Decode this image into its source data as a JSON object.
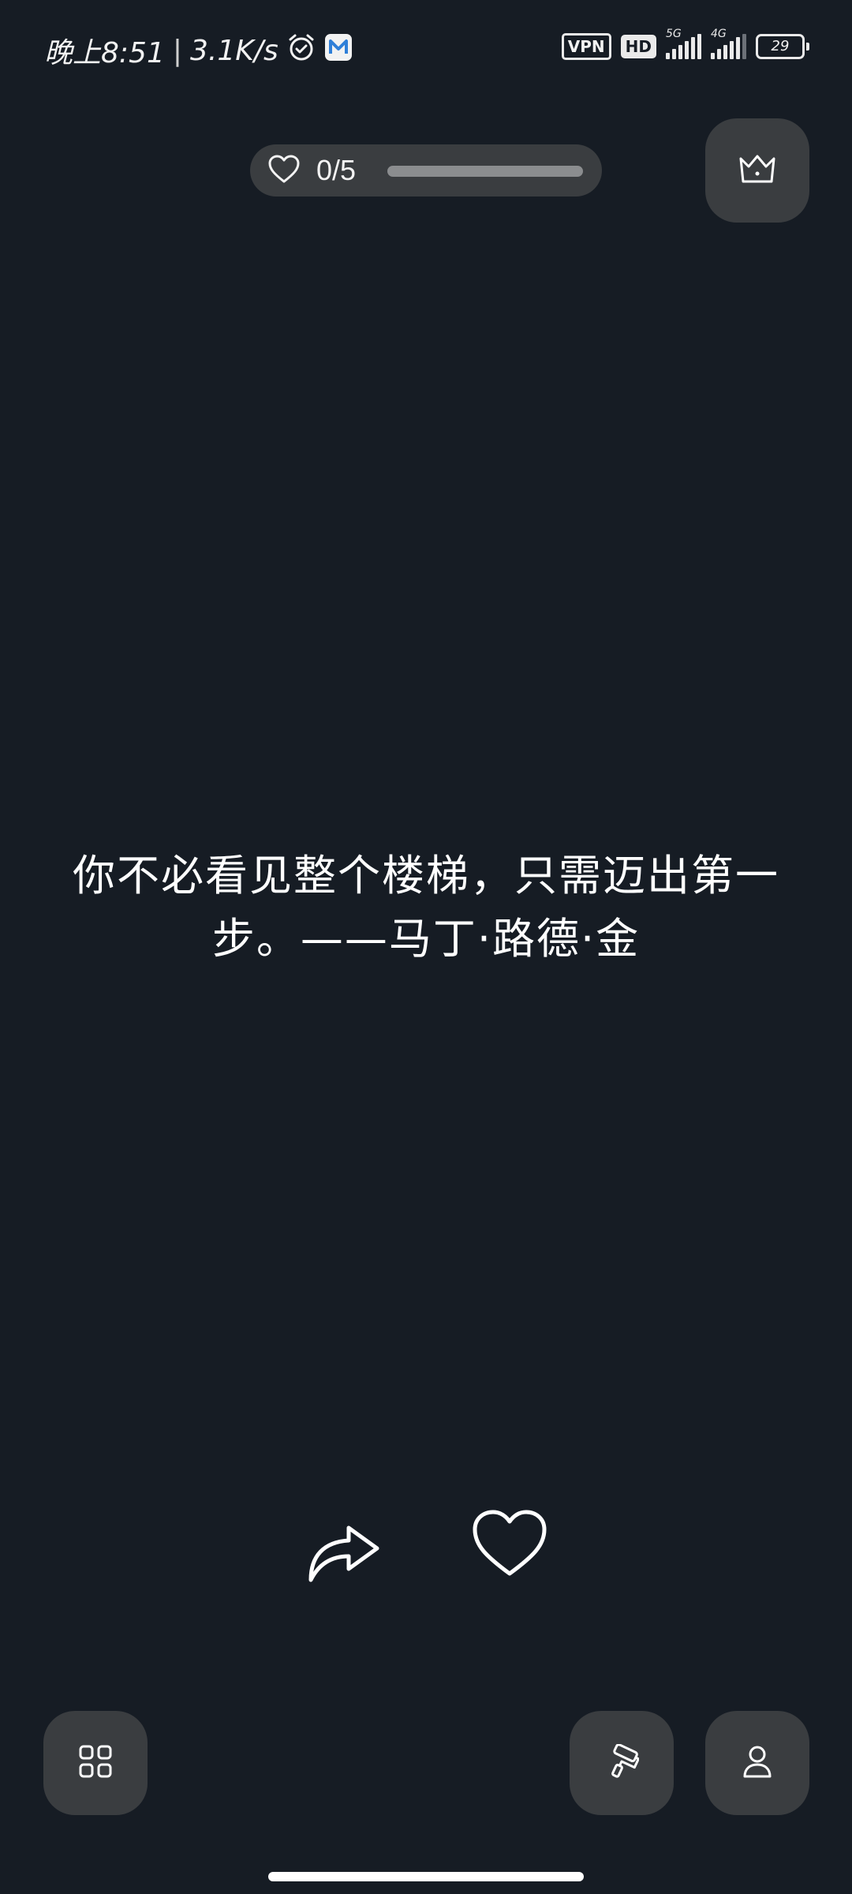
{
  "status_bar": {
    "time": "晚上8:51",
    "separator": "|",
    "net_speed": "3.1K/s",
    "alarm_icon": "alarm-clock-icon",
    "app_icon": "mail-m-icon",
    "vpn_badge": "VPN",
    "hd_badge": "HD",
    "net_type_1": "5G",
    "net_type_2": "4G",
    "battery": "29"
  },
  "progress": {
    "heart_icon": "heart-outline-icon",
    "count": "0/5",
    "value": 0
  },
  "premium": {
    "icon": "crown-icon"
  },
  "quote": {
    "text": "你不必看见整个楼梯，只需迈出第一步。——马丁·路德·金"
  },
  "actions": {
    "share_icon": "share-forward-icon",
    "like_icon": "heart-outline-icon"
  },
  "bottom_bar": {
    "left_icon": "grid-apps-icon",
    "theme_icon": "paint-roller-icon",
    "profile_icon": "user-profile-icon"
  },
  "colors": {
    "background": "#161c24",
    "button": "#3a3d40",
    "text": "#ffffff"
  }
}
